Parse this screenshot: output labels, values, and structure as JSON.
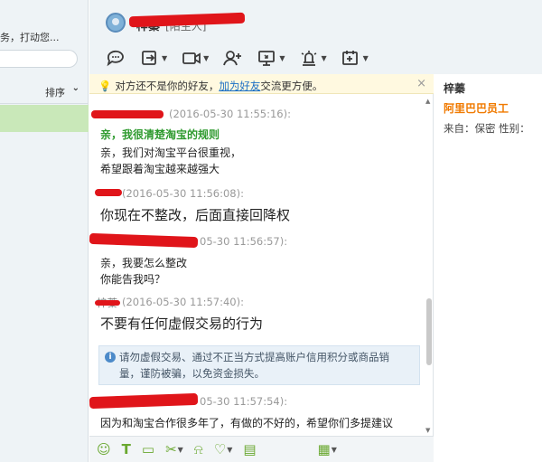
{
  "left_panel": {
    "status_text": "务，打动您...",
    "sort_label": "排序",
    "sort_chevron": "chevron-down-icon"
  },
  "header": {
    "contact_name": "梓蓁",
    "contact_note": "[陌生人]",
    "toolbar_icons": [
      "chat-bubble-icon",
      "transfer-file-icon",
      "video-call-icon",
      "add-contact-icon",
      "remote-screen-icon",
      "alarm-icon",
      "add-app-icon"
    ]
  },
  "notice": {
    "prefix": "对方还不是你的好友，",
    "link": "加为好友",
    "suffix": "交流更方便。",
    "close": "×"
  },
  "messages": [
    {
      "time": "(2016-05-30 11:55:16):",
      "lines": [
        "亲，我很清楚淘宝的规则",
        "亲，我们对淘宝平台很重视，",
        "希望跟着淘宝越来越强大"
      ]
    },
    {
      "time": "(2016-05-30 11:56:08):",
      "lines": [
        "你现在不整改，后面直接回降权"
      ]
    },
    {
      "time": "05-30 11:56:57):",
      "lines": [
        "亲，我要怎么整改",
        "你能告我吗？"
      ]
    },
    {
      "sender": "梓蓁",
      "time": "(2016-05-30 11:57:40):",
      "lines": [
        "不要有任何虚假交易的行为"
      ]
    },
    {
      "time": "05-30 11:57:54):",
      "lines": [
        "因为和淘宝合作很多年了，有做的不好的，希望你们多提建议"
      ]
    }
  ],
  "tip": {
    "line1": "请勿虚假交易、通过不正当方式提高账户信用积分或商品销",
    "line2": "量，谨防被骗，以免资金损失。"
  },
  "bottom_tools": [
    "emoji-icon",
    "font-icon",
    "image-icon",
    "scissors-icon",
    "bell-icon",
    "heart-icon",
    "document-icon",
    "history-icon"
  ],
  "right_panel": {
    "name": "梓蓁",
    "role": "阿里巴巴员工",
    "from_label": "来自：保密   性别："
  }
}
